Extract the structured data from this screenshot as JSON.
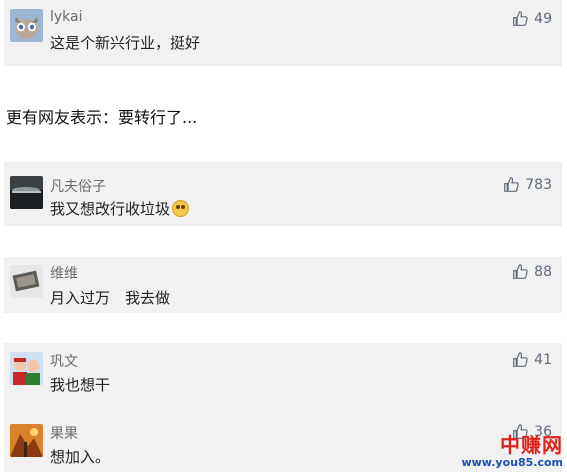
{
  "comments_top": {
    "user": "lykai",
    "text": "这是个新兴行业，挺好",
    "likes": "49"
  },
  "caption": "更有网友表示：要转行了...",
  "comments": [
    {
      "user": "凡夫俗子",
      "text": "我又想改行收垃圾",
      "likes": "783",
      "emoji": "dizzy-face-emoji"
    },
    {
      "user": "维维",
      "text": "月入过万　我去做",
      "likes": "88"
    },
    {
      "user": "巩文",
      "text": "我也想干",
      "likes": "41"
    },
    {
      "user": "果果",
      "text": "想加入。",
      "likes": "36"
    }
  ],
  "watermark": {
    "cn": "中赚网",
    "url": "www.you85.com"
  },
  "icons": {
    "like": "thumbs-up-icon"
  },
  "colors": {
    "card_bg": "#f1f1f1",
    "name": "#6b6f73",
    "likes": "#5f6a7d",
    "watermark_red": "#e0241b",
    "watermark_blue": "#1d4fb8"
  }
}
